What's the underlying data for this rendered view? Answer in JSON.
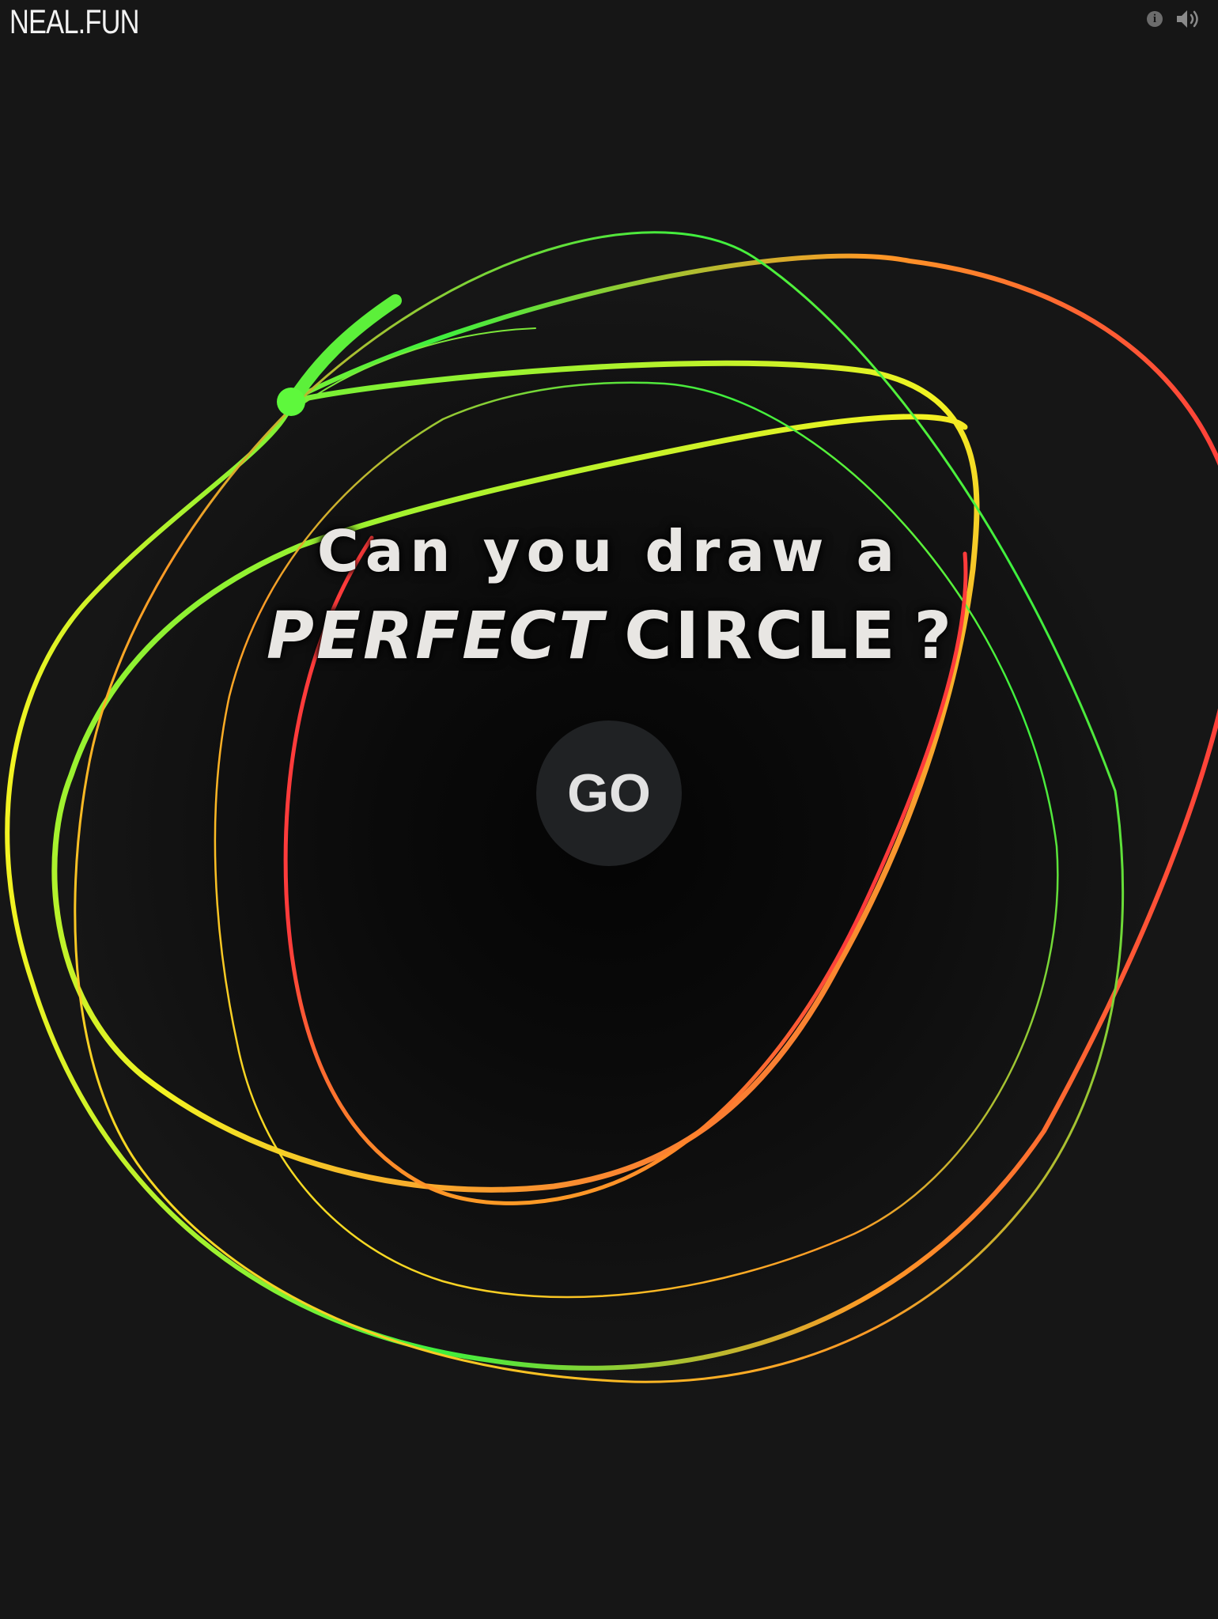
{
  "header": {
    "logo": "NEAL.FUN",
    "info_icon": "info-icon",
    "sound_icon": "speaker-volume-icon"
  },
  "headline": {
    "line1": "Can you draw a",
    "perfect": "PERFECT",
    "circle": "CIRCLE",
    "question_mark": "?"
  },
  "start": {
    "go_label": "GO"
  },
  "colors": {
    "background": "#161616",
    "text": "#e8e6e3",
    "button": "#202224",
    "scribble_red": "#ff3b3b",
    "scribble_orange": "#ff9a26",
    "scribble_yellow": "#f3f322",
    "scribble_green": "#3ef03e"
  }
}
